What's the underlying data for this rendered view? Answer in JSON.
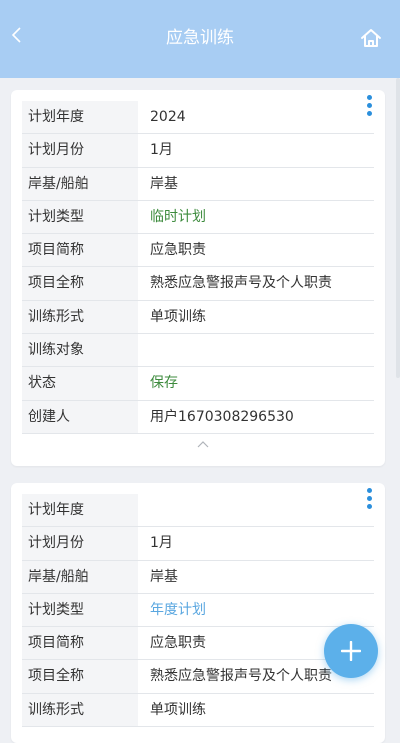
{
  "header": {
    "title": "应急训练"
  },
  "icons": {
    "back": "chevron-left-icon",
    "home": "home-icon",
    "more": "more-vertical-icon",
    "collapse": "chevron-up-icon",
    "add": "plus-icon"
  },
  "colors": {
    "header_bg": "#a8cdf3",
    "accent": "#2b8fdc",
    "status_green": "#3d8b3d",
    "type_blue": "#5aa7e0",
    "fab": "#5cb0ea"
  },
  "records": [
    {
      "plan_year_label": "计划年度",
      "plan_year": "2024",
      "plan_month_label": "计划月份",
      "plan_month": "1月",
      "shore_ship_label": "岸基/船舶",
      "shore_ship": "岸基",
      "plan_type_label": "计划类型",
      "plan_type": "临时计划",
      "short_name_label": "项目简称",
      "short_name": "应急职责",
      "full_name_label": "项目全称",
      "full_name": "熟悉应急警报声号及个人职责",
      "form_label": "训练形式",
      "form": "单项训练",
      "target_label": "训练对象",
      "target": "",
      "status_label": "状态",
      "status": "保存",
      "creator_label": "创建人",
      "creator": "用户1670308296530"
    },
    {
      "plan_year_label": "计划年度",
      "plan_year": "",
      "plan_month_label": "计划月份",
      "plan_month": "1月",
      "shore_ship_label": "岸基/船舶",
      "shore_ship": "岸基",
      "plan_type_label": "计划类型",
      "plan_type": "年度计划",
      "short_name_label": "项目简称",
      "short_name": "应急职责",
      "full_name_label": "项目全称",
      "full_name": "熟悉应急警报声号及个人职责",
      "form_label": "训练形式",
      "form": "单项训练"
    }
  ]
}
